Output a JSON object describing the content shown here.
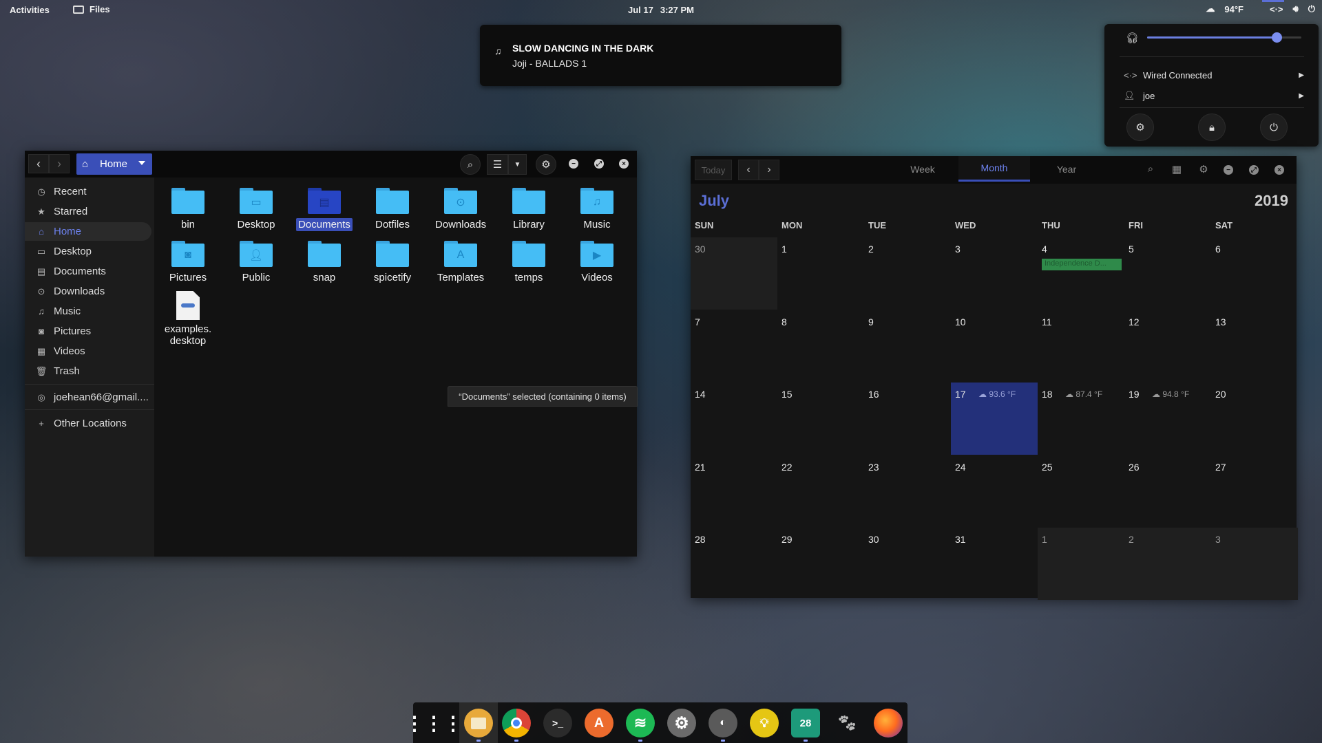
{
  "topbar": {
    "activities": "Activities",
    "app_name": "Files",
    "date": "Jul 17",
    "time": "3:27 PM",
    "weather": "94°F"
  },
  "notification": {
    "title": "SLOW DANCING IN THE DARK",
    "body": "Joji - BALLADS 1"
  },
  "system_menu": {
    "volume_percent": 84,
    "network_label": "Wired Connected",
    "user_label": "joe"
  },
  "files": {
    "location": "Home",
    "sidebar": [
      {
        "label": "Recent",
        "icon": "clock-icon"
      },
      {
        "label": "Starred",
        "icon": "star-icon"
      },
      {
        "label": "Home",
        "icon": "home-icon",
        "active": true
      },
      {
        "label": "Desktop",
        "icon": "desktop-icon"
      },
      {
        "label": "Documents",
        "icon": "documents-icon"
      },
      {
        "label": "Downloads",
        "icon": "downloads-icon"
      },
      {
        "label": "Music",
        "icon": "music-icon"
      },
      {
        "label": "Pictures",
        "icon": "pictures-icon"
      },
      {
        "label": "Videos",
        "icon": "videos-icon"
      },
      {
        "label": "Trash",
        "icon": "trash-icon"
      },
      {
        "label": "joehean66@gmail....",
        "icon": "online-account-icon"
      },
      {
        "label": "Other Locations",
        "icon": "plus-icon"
      }
    ],
    "items": [
      {
        "label": "bin"
      },
      {
        "label": "Desktop"
      },
      {
        "label": "Documents",
        "selected": true
      },
      {
        "label": "Dotfiles"
      },
      {
        "label": "Downloads"
      },
      {
        "label": "Library"
      },
      {
        "label": "Music"
      },
      {
        "label": "Pictures"
      },
      {
        "label": "Public"
      },
      {
        "label": "snap"
      },
      {
        "label": "spicetify"
      },
      {
        "label": "Templates"
      },
      {
        "label": "temps"
      },
      {
        "label": "Videos"
      },
      {
        "label": "examples.",
        "label2": "desktop"
      }
    ],
    "status": "“Documents” selected  (containing 0 items)"
  },
  "calendar": {
    "today_label": "Today",
    "views": [
      "Week",
      "Month",
      "Year"
    ],
    "active_view": "Month",
    "month": "July",
    "year": "2019",
    "weekdays": [
      "SUN",
      "MON",
      "TUE",
      "WED",
      "THU",
      "FRI",
      "SAT"
    ],
    "weeks": [
      [
        "30",
        "1",
        "2",
        "3",
        "4",
        "5",
        "6"
      ],
      [
        "7",
        "8",
        "9",
        "10",
        "11",
        "12",
        "13"
      ],
      [
        "14",
        "15",
        "16",
        "17",
        "18",
        "19",
        "20"
      ],
      [
        "21",
        "22",
        "23",
        "24",
        "25",
        "26",
        "27"
      ],
      [
        "28",
        "29",
        "30",
        "31",
        "1",
        "2",
        "3"
      ]
    ],
    "event_label": "Independence D...",
    "weather_17": "93.6 °F",
    "weather_18": "87.4 °F",
    "weather_19": "94.8 °F",
    "today_day": "17"
  },
  "dock": {
    "apps": [
      "app-grid-icon",
      "files-icon",
      "chrome-icon",
      "terminal-icon",
      "software-center-icon",
      "spotify-icon",
      "settings-icon",
      "tweaks-icon",
      "ideas-icon",
      "calendar-icon",
      "gimp-icon",
      "firefox-icon"
    ],
    "calendar_badge": "28"
  },
  "colors": {
    "accent": "#3a4fb8",
    "accent_text": "#6d82ee",
    "folder": "#45bdf5",
    "event": "#2f8a4a"
  }
}
